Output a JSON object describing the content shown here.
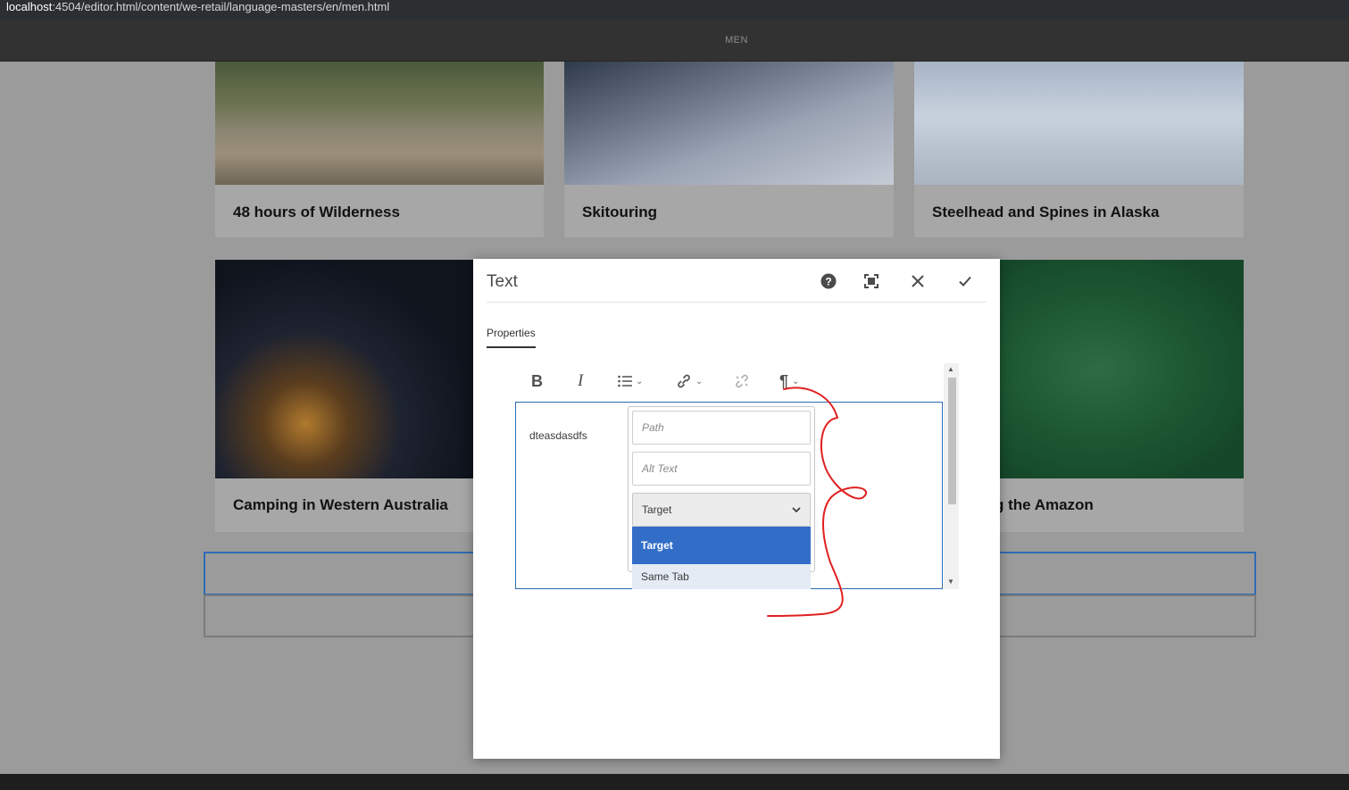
{
  "browser": {
    "url_host": "localhost",
    "url_rest": ":4504/editor.html/content/we-retail/language-masters/en/men.html"
  },
  "editor_header": {
    "title": "MEN"
  },
  "cards": [
    {
      "label": "48 hours of Wilderness"
    },
    {
      "label": "Skitouring"
    },
    {
      "label": "Steelhead and Spines in Alaska"
    },
    {
      "label": "Camping in Western Australia"
    },
    {
      "label": "g the Amazon"
    }
  ],
  "dialog": {
    "title": "Text",
    "help_icon": "help-icon",
    "fullscreen_icon": "fullscreen-icon",
    "close_icon": "close-icon",
    "done_icon": "check-icon",
    "tab_label": "Properties",
    "toolbar": {
      "bold": "B",
      "italic": "I",
      "paragraph": "¶"
    },
    "editor_text": "dteasdasdfs",
    "link_popover": {
      "path_placeholder": "Path",
      "alt_placeholder": "Alt Text",
      "target_selected": "Target",
      "options": [
        "Target",
        "Same Tab"
      ]
    }
  },
  "colors": {
    "accent": "#326ec8",
    "focus_border": "#2d6bb4",
    "annotation": "#e02020"
  }
}
